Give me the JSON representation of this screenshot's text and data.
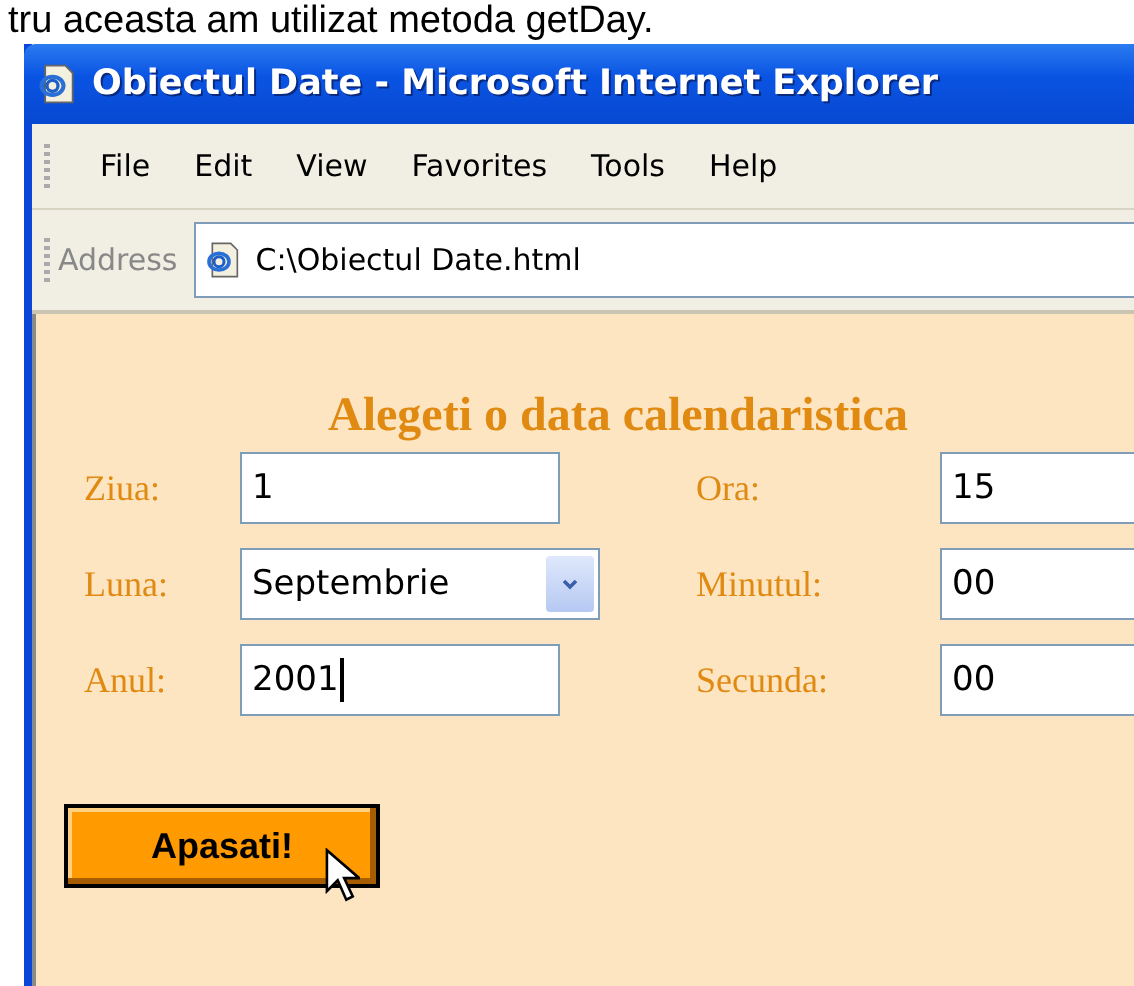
{
  "caption": "tru aceasta am utilizat metoda getDay.",
  "window": {
    "title": "Obiectul Date - Microsoft Internet Explorer"
  },
  "menu": [
    "File",
    "Edit",
    "View",
    "Favorites",
    "Tools",
    "Help"
  ],
  "address_bar": {
    "label": "Address",
    "value": "C:\\Obiectul Date.html"
  },
  "form": {
    "heading": "Alegeti o data calendaristica",
    "fields": [
      {
        "label": "Ziua:",
        "kind": "text",
        "value": "1",
        "focused": false
      },
      {
        "label": "Ora:",
        "kind": "text",
        "value": "15",
        "focused": false
      },
      {
        "label": "Luna:",
        "kind": "select",
        "value": "Septembrie",
        "focused": false
      },
      {
        "label": "Minutul:",
        "kind": "text",
        "value": "00",
        "focused": false
      },
      {
        "label": "Anul:",
        "kind": "text",
        "value": "2001",
        "focused": true
      },
      {
        "label": "Secunda:",
        "kind": "text",
        "value": "00",
        "focused": false
      }
    ],
    "button": "Apasati!"
  }
}
